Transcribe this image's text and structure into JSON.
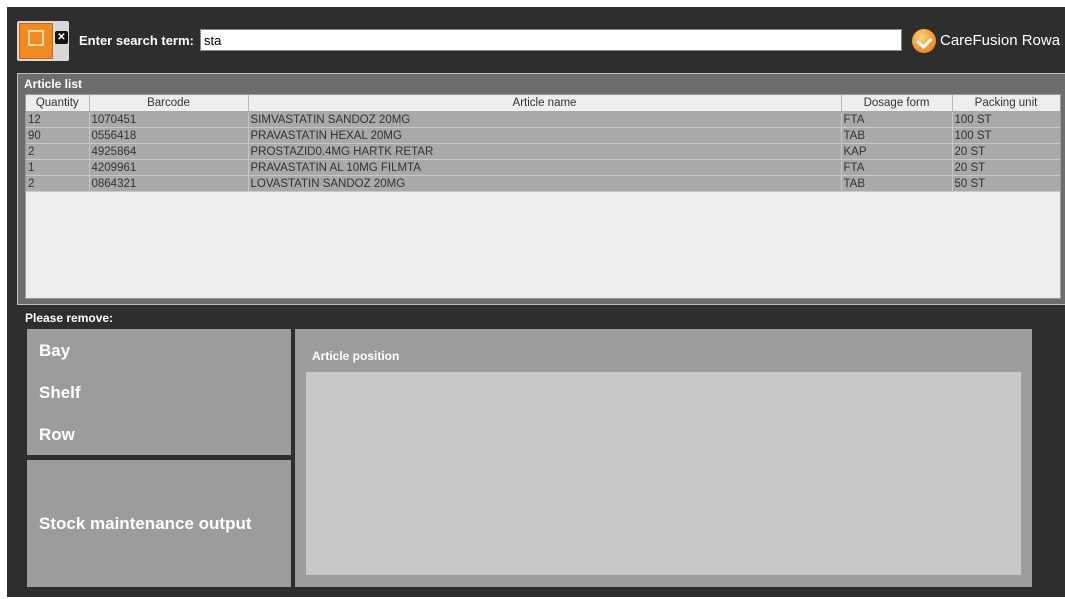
{
  "search": {
    "label": "Enter search term:",
    "value": "sta"
  },
  "brand": {
    "text": "CareFusion  Rowa",
    "icon": "carefusion-logo-icon"
  },
  "logout_icon": "logout-icon",
  "article_list": {
    "title": "Article list",
    "columns": [
      "Quantity",
      "Barcode",
      "Article name",
      "Dosage form",
      "Packing unit"
    ],
    "rows": [
      {
        "quantity": "12",
        "barcode": "1070451",
        "name": "SIMVASTATIN SANDOZ 20MG",
        "dosage": "FTA",
        "packing": "100 ST"
      },
      {
        "quantity": "90",
        "barcode": "0556418",
        "name": "PRAVASTATIN HEXAL 20MG",
        "dosage": "TAB",
        "packing": "100 ST"
      },
      {
        "quantity": "2",
        "barcode": "4925864",
        "name": "PROSTAZID0.4MG HARTK RETAR",
        "dosage": "KAP",
        "packing": "20 ST"
      },
      {
        "quantity": "1",
        "barcode": "4209961",
        "name": "PRAVASTATIN AL 10MG FILMTA",
        "dosage": "FTA",
        "packing": "20 ST"
      },
      {
        "quantity": "2",
        "barcode": "0864321",
        "name": "LOVASTATIN SANDOZ 20MG",
        "dosage": "TAB",
        "packing": "50 ST"
      }
    ]
  },
  "remove": {
    "title": "Please remove:",
    "bay": "Bay",
    "shelf": "Shelf",
    "row": "Row",
    "stock_output": "Stock maintenance output",
    "article_position": "Article position"
  },
  "colors": {
    "accent": "#f18a21",
    "background": "#2e2e2e",
    "panel": "#9c9c9c"
  }
}
